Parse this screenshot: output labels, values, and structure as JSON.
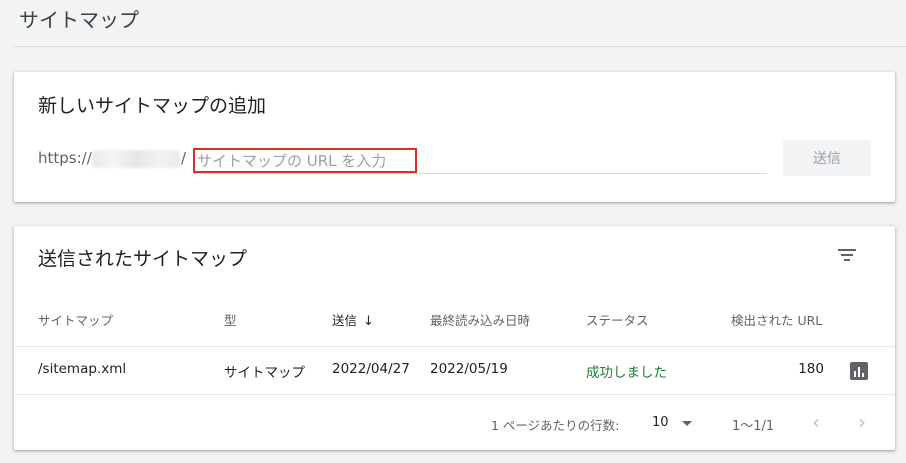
{
  "page": {
    "title": "サイトマップ"
  },
  "add_card": {
    "title": "新しいサイトマップの追加",
    "url_prefix": "https://",
    "url_slash": "/",
    "input_placeholder": "サイトマップの URL を入力",
    "input_value": "",
    "submit_label": "送信"
  },
  "list_card": {
    "title": "送信されたサイトマップ",
    "columns": {
      "sitemap": "サイトマップ",
      "type": "型",
      "submitted": "送信",
      "last_read": "最終読み込み日時",
      "status": "ステータス",
      "discovered": "検出された URL"
    },
    "sort_icon": "arrow-down-icon",
    "rows": [
      {
        "sitemap": "/sitemap.xml",
        "type": "サイトマップ",
        "submitted": "2022/04/27",
        "last_read": "2022/05/19",
        "status": "成功しました",
        "discovered": "180"
      }
    ],
    "status_color": "#188038",
    "pagination": {
      "rows_per_page_label": "1 ページあたりの行数:",
      "rows_per_page_value": "10",
      "range": "1〜1/1",
      "prev_icon": "chevron-left-icon",
      "next_icon": "chevron-right-icon"
    }
  }
}
